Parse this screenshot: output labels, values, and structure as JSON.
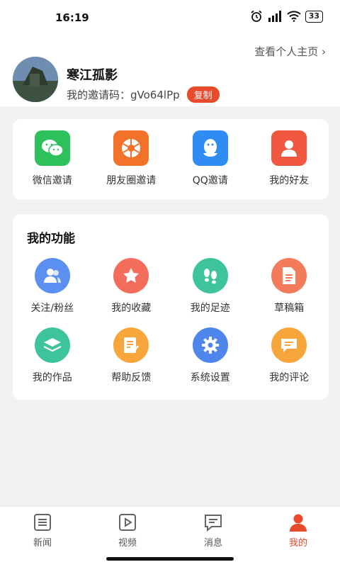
{
  "status_bar": {
    "time": "16:19",
    "battery": "33"
  },
  "profile": {
    "view_home": "查看个人主页",
    "username": "寒江孤影",
    "invite_label": "我的邀请码：",
    "invite_code": "gVo64lPp",
    "copy_label": "复制"
  },
  "invite": {
    "items": [
      {
        "label": "微信邀请",
        "icon": "wechat-icon",
        "color": "#2ec05a"
      },
      {
        "label": "朋友圈邀请",
        "icon": "moments-icon",
        "color": "#f2722a"
      },
      {
        "label": "QQ邀请",
        "icon": "qq-icon",
        "color": "#2f8cf3"
      },
      {
        "label": "我的好友",
        "icon": "friend-icon",
        "color": "#f0573f"
      }
    ]
  },
  "functions": {
    "title": "我的功能",
    "items": [
      {
        "label": "关注/粉丝",
        "icon": "users-icon",
        "color": "#5b8ff0"
      },
      {
        "label": "我的收藏",
        "icon": "star-icon",
        "color": "#f36d5a"
      },
      {
        "label": "我的足迹",
        "icon": "footprint-icon",
        "color": "#3ec49a"
      },
      {
        "label": "草稿箱",
        "icon": "draft-icon",
        "color": "#f37a5a"
      },
      {
        "label": "我的作品",
        "icon": "layers-icon",
        "color": "#3ec49a"
      },
      {
        "label": "帮助反馈",
        "icon": "feedback-icon",
        "color": "#f7a63c"
      },
      {
        "label": "系统设置",
        "icon": "gear-icon",
        "color": "#4f86ec"
      },
      {
        "label": "我的评论",
        "icon": "comment-icon",
        "color": "#f7a63c"
      }
    ]
  },
  "tabbar": {
    "tabs": [
      {
        "label": "新闻",
        "icon": "news-icon"
      },
      {
        "label": "视频",
        "icon": "video-icon"
      },
      {
        "label": "消息",
        "icon": "message-icon"
      },
      {
        "label": "我的",
        "icon": "profile-icon"
      }
    ],
    "active_color": "#e94a2c"
  }
}
